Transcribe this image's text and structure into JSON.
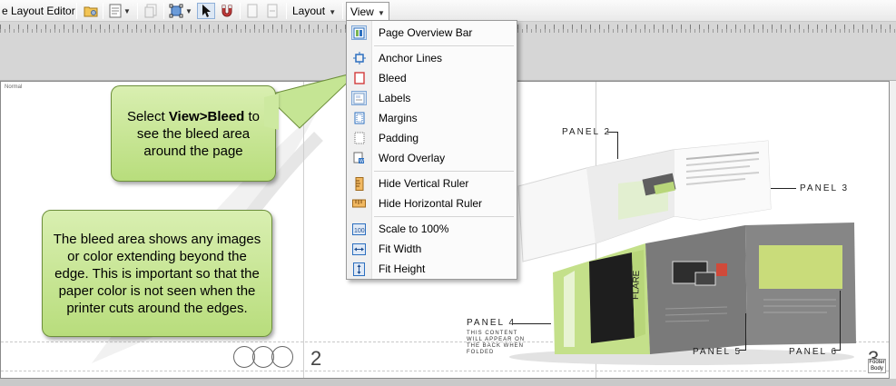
{
  "toolbar": {
    "editor_label": "e Layout Editor",
    "layout_menu": "Layout",
    "view_menu": "View"
  },
  "page": {
    "corner_label": "Normal",
    "page_number_left": "2",
    "page_number_right": "3",
    "footer_tag": "Footer Body"
  },
  "callouts": {
    "bleed_prefix": "Select ",
    "bleed_bold": "View>Bleed",
    "bleed_suffix": " to see the bleed area around the page",
    "info": "The bleed area shows any images or color extending beyond the edge. This is important so that the paper color is not seen when the printer cuts around the edges."
  },
  "view_menu": {
    "items": [
      {
        "label": "Page Overview Bar",
        "icon": "page-overview-icon",
        "checked": true
      },
      {
        "label": "Anchor Lines",
        "icon": "anchor-lines-icon",
        "checked": false
      },
      {
        "label": "Bleed",
        "icon": "bleed-icon",
        "checked": false
      },
      {
        "label": "Labels",
        "icon": "labels-icon",
        "checked": true
      },
      {
        "label": "Margins",
        "icon": "margins-icon",
        "checked": false
      },
      {
        "label": "Padding",
        "icon": "padding-icon",
        "checked": false
      },
      {
        "label": "Word Overlay",
        "icon": "word-overlay-icon",
        "checked": false
      },
      {
        "label": "Hide Vertical Ruler",
        "icon": "vertical-ruler-icon",
        "checked": false
      },
      {
        "label": "Hide Horizontal Ruler",
        "icon": "horizontal-ruler-icon",
        "checked": false
      },
      {
        "label": "Scale to 100%",
        "icon": "scale-100-icon",
        "checked": false
      },
      {
        "label": "Fit Width",
        "icon": "fit-width-icon",
        "checked": false
      },
      {
        "label": "Fit Height",
        "icon": "fit-height-icon",
        "checked": false
      }
    ]
  },
  "brochure": {
    "panel2": "PANEL 2",
    "panel3": "PANEL 3",
    "panel4": "PANEL 4",
    "panel5": "PANEL 5",
    "panel6": "PANEL 6",
    "panel4_note": "THIS CONTENT WILL APPEAR ON THE BACK WHEN FOLDED",
    "product_name": "FLARE"
  },
  "colors": {
    "callout_fill": "#c5e594",
    "callout_border": "#6d8f3b",
    "brochure_green": "#c4e08a",
    "brochure_gray": "#7a7a7a"
  }
}
